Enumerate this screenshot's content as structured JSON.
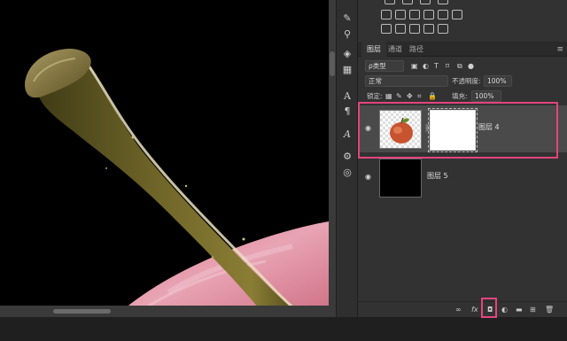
{
  "layers_panel": {
    "tabs": [
      "图层",
      "通道",
      "路径"
    ],
    "filter_kind": "ρ类型",
    "blend_mode": "正常",
    "opacity_label": "不透明度:",
    "opacity_value": "100%",
    "lock_label": "锁定:",
    "fill_label": "填充:",
    "fill_value": "100%",
    "layers": [
      {
        "name": "图层 4",
        "selected": true,
        "thumbnail": "apple",
        "has_mask": true
      },
      {
        "name": "图层 5",
        "selected": false,
        "thumbnail": "black",
        "has_mask": false
      }
    ],
    "bottom_icons": [
      "link-icon",
      "fx-icon",
      "add-mask-icon",
      "adjustment-icon",
      "folder-icon",
      "new-layer-icon",
      "trash-icon"
    ],
    "fx_label": "fx"
  },
  "colors": {
    "highlight": "#e3457d",
    "panel_bg": "#323232",
    "selected_layer_bg": "#4a4a4a",
    "canvas_bg": "#000000"
  }
}
